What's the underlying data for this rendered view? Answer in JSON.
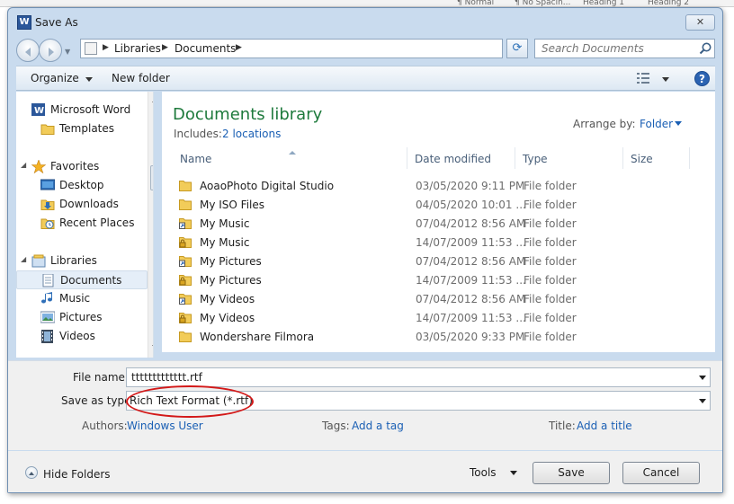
{
  "background_ribbon": {
    "tiles": [
      "¶ Normal",
      "¶ No Spacin...",
      "Heading 1",
      "Heading 2"
    ]
  },
  "window": {
    "title": "Save As",
    "app_icon_letter": "W",
    "close_glyph": "✕"
  },
  "address_bar": {
    "crumbs": [
      "Libraries",
      "Documents"
    ],
    "separator_glyph": "▶",
    "search_placeholder": "Search Documents"
  },
  "toolbar": {
    "organize_label": "Organize",
    "new_folder_label": "New folder",
    "help_glyph": "?"
  },
  "nav": {
    "items": [
      {
        "label": "Microsoft Word",
        "icon": "word-icon",
        "selected": false
      },
      {
        "label": "Templates",
        "icon": "folder-icon",
        "selected": false
      },
      {
        "label": "Favorites",
        "icon": "star-icon",
        "selected": false
      },
      {
        "label": "Desktop",
        "icon": "desktop-icon",
        "selected": false
      },
      {
        "label": "Downloads",
        "icon": "downloads-icon",
        "selected": false
      },
      {
        "label": "Recent Places",
        "icon": "recent-places-icon",
        "selected": false
      },
      {
        "label": "Libraries",
        "icon": "libraries-icon",
        "selected": false
      },
      {
        "label": "Documents",
        "icon": "documents-icon",
        "selected": true
      },
      {
        "label": "Music",
        "icon": "music-icon",
        "selected": false
      },
      {
        "label": "Pictures",
        "icon": "pictures-icon",
        "selected": false
      },
      {
        "label": "Videos",
        "icon": "videos-icon",
        "selected": false
      }
    ]
  },
  "library": {
    "title": "Documents library",
    "includes_label": "Includes:",
    "locations_link": "2 locations",
    "arrange_label": "Arrange by:",
    "arrange_value": "Folder"
  },
  "columns": [
    "Name",
    "Date modified",
    "Type",
    "Size"
  ],
  "files": [
    {
      "name": "AoaoPhoto Digital Studio",
      "date": "03/05/2020 9:11 PM",
      "type": "File folder",
      "icon": "folder-icon"
    },
    {
      "name": "My ISO Files",
      "date": "04/05/2020 10:01 ...",
      "type": "File folder",
      "icon": "folder-icon"
    },
    {
      "name": "My Music",
      "date": "07/04/2012 8:56 AM",
      "type": "File folder",
      "icon": "shortcut-icon"
    },
    {
      "name": "My Music",
      "date": "14/07/2009 11:53 ...",
      "type": "File folder",
      "icon": "lock-icon"
    },
    {
      "name": "My Pictures",
      "date": "07/04/2012 8:56 AM",
      "type": "File folder",
      "icon": "shortcut-icon"
    },
    {
      "name": "My Pictures",
      "date": "14/07/2009 11:53 ...",
      "type": "File folder",
      "icon": "lock-icon"
    },
    {
      "name": "My Videos",
      "date": "07/04/2012 8:56 AM",
      "type": "File folder",
      "icon": "shortcut-icon"
    },
    {
      "name": "My Videos",
      "date": "14/07/2009 11:53 ...",
      "type": "File folder",
      "icon": "lock-icon"
    },
    {
      "name": "Wondershare Filmora",
      "date": "03/05/2020 9:33 PM",
      "type": "File folder",
      "icon": "folder-icon"
    }
  ],
  "form": {
    "file_name_label": "File name:",
    "file_name_value": "ttttttttttttt.rtf",
    "save_type_label": "Save as type:",
    "save_type_value": "Rich Text Format (*.rtf)",
    "authors_label": "Authors:",
    "authors_value": "Windows User",
    "tags_label": "Tags:",
    "tags_value": "Add a tag",
    "title_label": "Title:",
    "title_value": "Add a title"
  },
  "footer": {
    "hide_folders_label": "Hide Folders",
    "tools_label": "Tools",
    "save_label": "Save",
    "cancel_label": "Cancel"
  },
  "colors": {
    "library_title": "#1e7a3c",
    "link": "#1a5fb4",
    "annotation": "#d31818",
    "dialog_frame": "#c9dbee"
  }
}
